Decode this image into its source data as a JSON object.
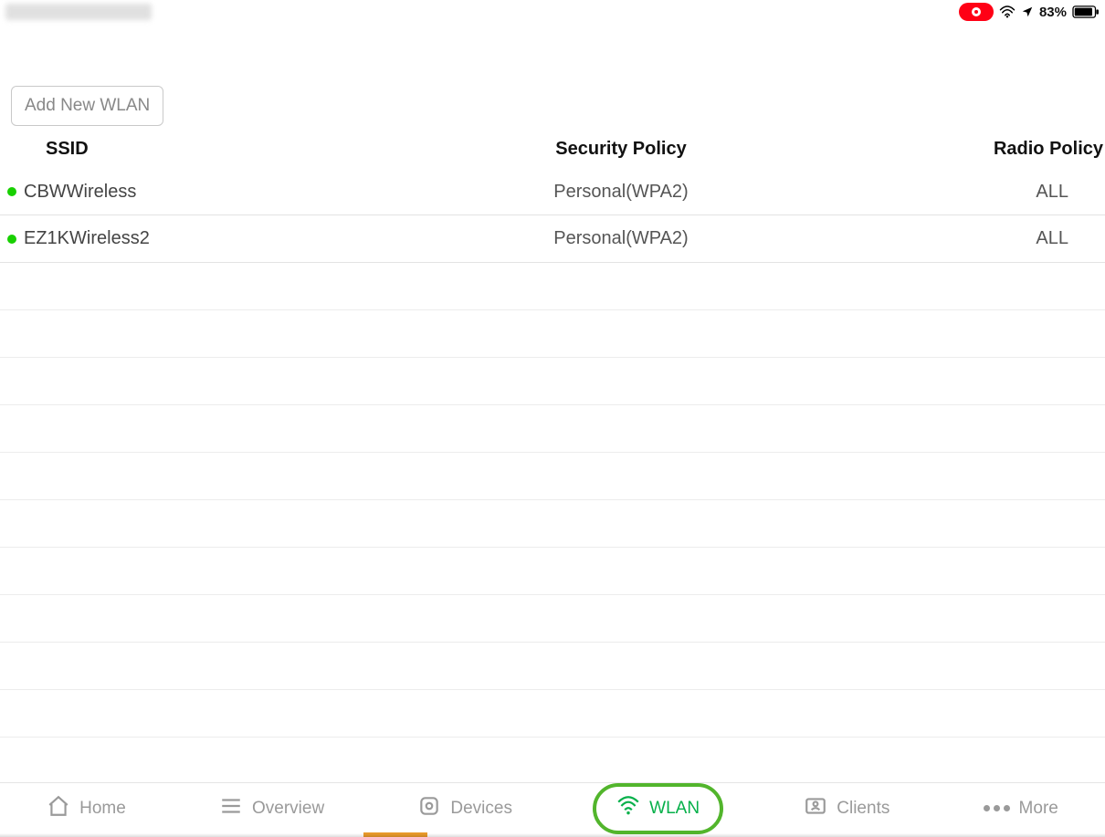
{
  "status": {
    "battery_text": "83%",
    "recording": true
  },
  "actions": {
    "add_wlan_label": "Add New WLAN"
  },
  "table": {
    "headers": {
      "ssid": "SSID",
      "security": "Security Policy",
      "radio": "Radio Policy"
    },
    "rows": [
      {
        "status": "up",
        "ssid": "CBWWireless",
        "security": "Personal(WPA2)",
        "radio": "ALL"
      },
      {
        "status": "up",
        "ssid": "EZ1KWireless2",
        "security": "Personal(WPA2)",
        "radio": "ALL"
      }
    ]
  },
  "tabs": {
    "home": "Home",
    "overview": "Overview",
    "devices": "Devices",
    "wlan": "WLAN",
    "clients": "Clients",
    "more": "More",
    "active": "wlan"
  }
}
